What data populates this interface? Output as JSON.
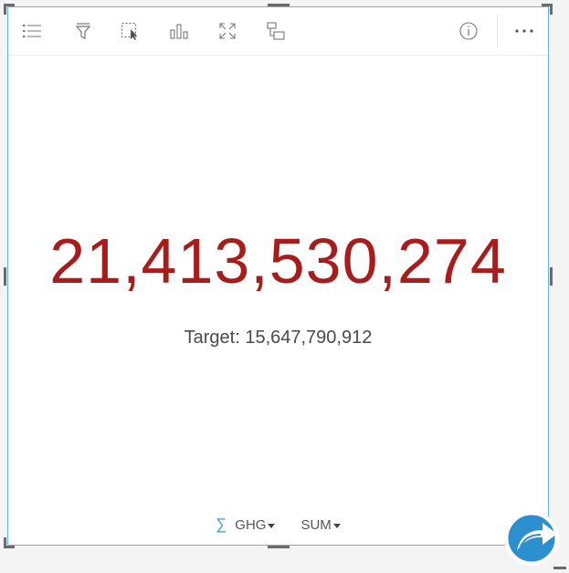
{
  "toolbar": {
    "buttons": [
      {
        "name": "legend-button",
        "icon": "list-icon"
      },
      {
        "name": "filter-button",
        "icon": "filter-funnel-icon"
      },
      {
        "name": "select-button",
        "icon": "selection-cursor-icon"
      },
      {
        "name": "visualization-type-button",
        "icon": "bar-chart-icon"
      },
      {
        "name": "maximize-button",
        "icon": "expand-arrows-icon"
      },
      {
        "name": "flip-card-button",
        "icon": "flip-card-icon"
      },
      {
        "name": "info-button",
        "icon": "info-circle-icon"
      },
      {
        "name": "more-options-button",
        "icon": "ellipsis-icon"
      }
    ],
    "more_label": "···"
  },
  "kpi": {
    "value": "21,413,530,274",
    "target": "Target: 15,647,790,912",
    "value_color": "#a81c1c"
  },
  "footer": {
    "field_symbol": "∑",
    "field_label": "GHG",
    "stat_label": "SUM"
  },
  "colors": {
    "border": "#5fb3e6",
    "accent": "#3c9fd8",
    "fab": "#2b8fd0"
  }
}
